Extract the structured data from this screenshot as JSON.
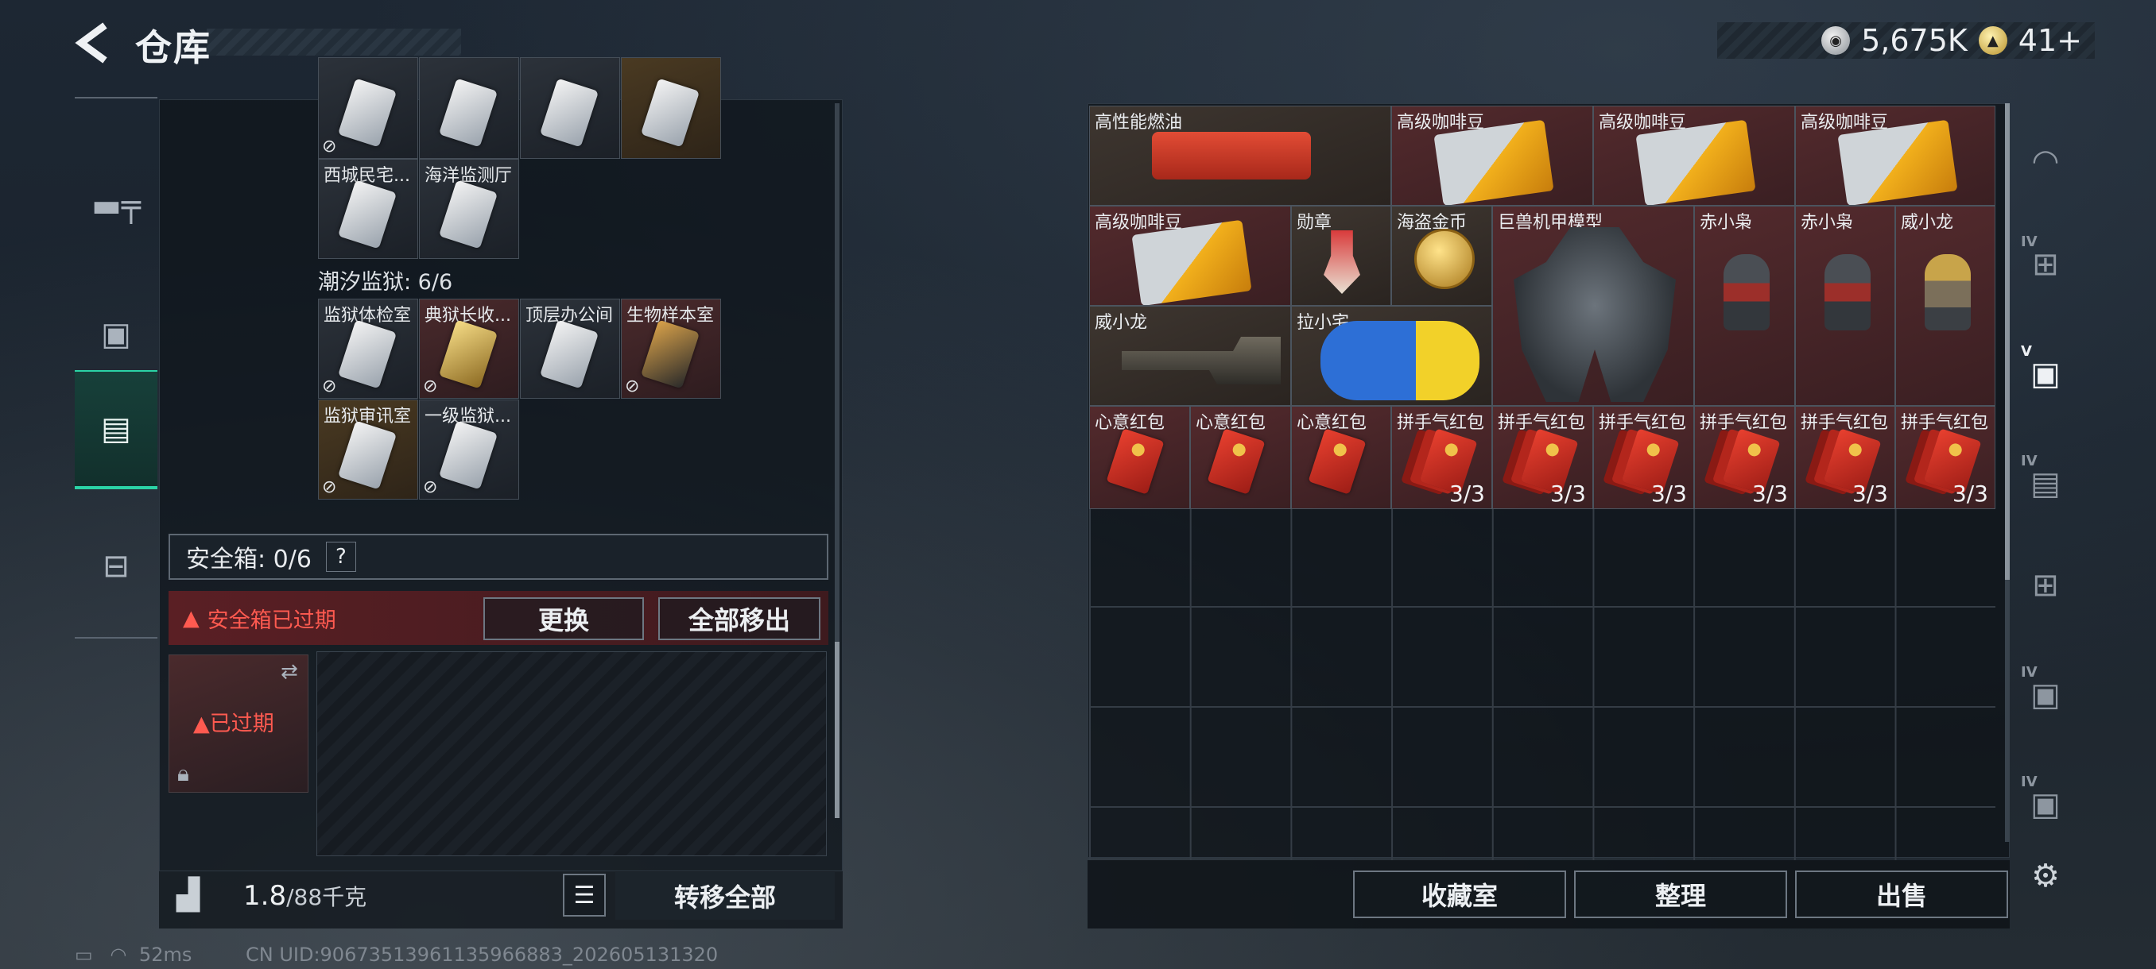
{
  "header": {
    "title": "仓库",
    "silver": "5,675K",
    "gold": "41+"
  },
  "nav": [
    {
      "name": "weapons-nav",
      "icon": "gun-icon",
      "glyph": "╤"
    },
    {
      "name": "armor-nav",
      "icon": "backpack-icon",
      "glyph": "▣"
    },
    {
      "name": "container-nav",
      "icon": "case-icon",
      "glyph": "▤"
    },
    {
      "name": "toolbox-nav",
      "icon": "toolbox-icon",
      "glyph": "⊟"
    }
  ],
  "left": {
    "cards_row0": [
      "",
      "",
      "",
      ""
    ],
    "row1": [
      {
        "label": "西城民宅..."
      },
      {
        "label": "海洋监测厅"
      }
    ],
    "section": "潮汐监狱: 6/6",
    "row2": [
      {
        "label": "监狱体检室"
      },
      {
        "label": "典狱长收..."
      },
      {
        "label": "顶层办公间"
      },
      {
        "label": "生物样本室"
      }
    ],
    "row3": [
      {
        "label": "监狱审讯室"
      },
      {
        "label": "一级监狱..."
      }
    ],
    "safe_label": "安全箱: 0/6",
    "help": "?",
    "expired_msg": "安全箱已过期",
    "replace_btn": "更换",
    "remove_all_btn": "全部移出",
    "safebox_status": "已过期",
    "weight_value": "1.8",
    "weight_unit": "/88千克",
    "transfer_all": "转移全部"
  },
  "status": {
    "ping": "52ms",
    "uid": "CN UID:9067351396113596688​3_202605131320"
  },
  "right": {
    "items": [
      {
        "label": "高性能燃油"
      },
      {
        "label": "高级咖啡豆"
      },
      {
        "label": "高级咖啡豆"
      },
      {
        "label": "高级咖啡豆"
      },
      {
        "label": "高级咖啡豆"
      },
      {
        "label": "勋章"
      },
      {
        "label": "海盗金币"
      },
      {
        "label": "巨兽机甲模型"
      },
      {
        "label": "赤小枭"
      },
      {
        "label": "赤小枭"
      },
      {
        "label": "威小龙"
      },
      {
        "label": "威小龙"
      },
      {
        "label": "拉小宅"
      },
      {
        "label": "心意红包"
      },
      {
        "label": "心意红包"
      },
      {
        "label": "心意红包"
      },
      {
        "label": "拼手气红包",
        "count": "3/3"
      },
      {
        "label": "拼手气红包",
        "count": "3/3"
      },
      {
        "label": "拼手气红包",
        "count": "3/3"
      },
      {
        "label": "拼手气红包",
        "count": "3/3"
      },
      {
        "label": "拼手气红包",
        "count": "3/3"
      },
      {
        "label": "拼手气红包",
        "count": "3/3"
      }
    ],
    "btn_collection": "收藏室",
    "btn_sort": "整理",
    "btn_sell": "出售"
  },
  "tools": [
    {
      "name": "helmet-tool",
      "icon": "helmet-icon"
    },
    {
      "name": "iv-add-tool",
      "icon": "iv-add-icon",
      "tag": "IV"
    },
    {
      "name": "v-vault-tool",
      "icon": "v-vault-icon",
      "tag": "V"
    },
    {
      "name": "iv-folder-tool",
      "icon": "iv-folder-icon",
      "tag": "IV"
    },
    {
      "name": "add-tool",
      "icon": "add-box-icon"
    },
    {
      "name": "iv-vault-tool",
      "icon": "iv-vault-icon",
      "tag": "IV"
    },
    {
      "name": "iv-vault2-tool",
      "icon": "iv-vault2-icon",
      "tag": "IV"
    },
    {
      "name": "settings-tool",
      "icon": "gear-icon"
    }
  ]
}
